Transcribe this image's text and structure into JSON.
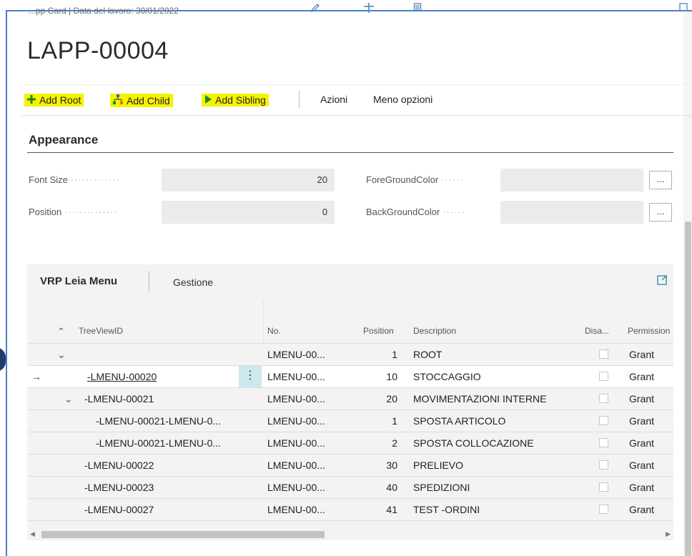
{
  "breadcrumb": "...pp Card | Data del lavoro: 30/01/2022",
  "page_title": "LAPP-00004",
  "actions": {
    "add_root": "Add Root",
    "add_child": "Add Child",
    "add_sibling": "Add Sibling",
    "azioni": "Azioni",
    "meno_opzioni": "Meno opzioni"
  },
  "appearance": {
    "title": "Appearance",
    "font_size_label": "Font Size",
    "font_size_value": "20",
    "position_label": "Position",
    "position_value": "0",
    "forecolor_label": "ForeGroundColor",
    "forecolor_value": "",
    "backcolor_label": "BackGroundColor",
    "backcolor_value": "",
    "ellipsis": "..."
  },
  "part": {
    "title": "VRP Leia Menu",
    "tab": "Gestione"
  },
  "grid": {
    "columns": {
      "treeview": "TreeViewID",
      "no": "No.",
      "position": "Position",
      "description": "Description",
      "disabled": "Disa...",
      "permission": "Permission"
    },
    "rows": [
      {
        "treeview": "",
        "no": "LMENU-00...",
        "position": "1",
        "description": "ROOT",
        "permission": "Grant"
      },
      {
        "treeview": "-LMENU-00020",
        "no": "LMENU-00...",
        "position": "10",
        "description": "STOCCAGGIO",
        "permission": "Grant"
      },
      {
        "treeview": "-LMENU-00021",
        "no": "LMENU-00...",
        "position": "20",
        "description": "MOVIMENTAZIONI INTERNE",
        "permission": "Grant"
      },
      {
        "treeview": "-LMENU-00021-LMENU-0...",
        "no": "LMENU-00...",
        "position": "1",
        "description": "SPOSTA ARTICOLO",
        "permission": "Grant"
      },
      {
        "treeview": "-LMENU-00021-LMENU-0...",
        "no": "LMENU-00...",
        "position": "2",
        "description": "SPOSTA COLLOCAZIONE",
        "permission": "Grant"
      },
      {
        "treeview": "-LMENU-00022",
        "no": "LMENU-00...",
        "position": "30",
        "description": "PRELIEVO",
        "permission": "Grant"
      },
      {
        "treeview": "-LMENU-00023",
        "no": "LMENU-00...",
        "position": "40",
        "description": "SPEDIZIONI",
        "permission": "Grant"
      },
      {
        "treeview": "-LMENU-00027",
        "no": "LMENU-00...",
        "position": "41",
        "description": "TEST -ORDINI",
        "permission": "Grant"
      }
    ]
  },
  "icons": {
    "row_pointer": "→",
    "expand": "⌄",
    "collapse_all": "⌃",
    "row_menu": "⋮",
    "add_root_icon": "plus-icon",
    "add_child_icon": "hierarchy-icon",
    "add_sibling_icon": "play-icon"
  },
  "colors": {
    "highlight": "#f7f200",
    "accent": "#4a7fc4",
    "selected_cell": "#cde8ee"
  }
}
